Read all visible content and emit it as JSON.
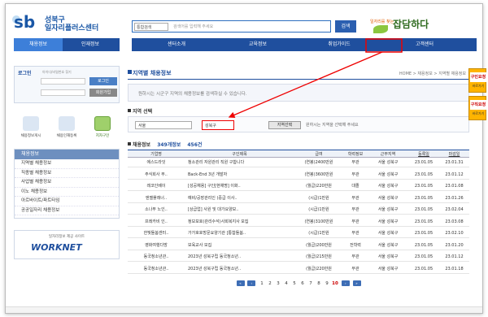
{
  "header": {
    "logo_mark": "sb",
    "logo_line1": "성북구",
    "logo_line2": "일자리플러스센터",
    "search_select": "통합검색",
    "search_placeholder": "검색어를 입력해 주세요",
    "search_button": "검색",
    "banner_small": "일자리를 찾는",
    "banner_big": "잡담하다"
  },
  "nav": {
    "left_tabs": [
      "채용정보",
      "인재정보"
    ],
    "right_tabs": [
      "센터소개",
      "교육정보",
      "취업가이드",
      "고객센터"
    ]
  },
  "sidebar": {
    "login_title": "로그인",
    "login_hint": "아이디/비밀번호 찾기",
    "login_button": "로그인",
    "join_button": "회원가입",
    "quick_items": [
      "채용정보게시",
      "채용인재등록",
      "지자구인"
    ],
    "job_menu_title": "채용정보",
    "job_menu_items": [
      "지역별 채용정보",
      "직종별 채용정보",
      "사업별 채용정보",
      "이노 채용정보",
      "아르바이트/파트타임",
      "공공일자리 채용정보"
    ],
    "work_top": "일자리정보 제공 사이트",
    "work_logo": "WORKNET"
  },
  "main": {
    "title": "지역별 채용정보",
    "breadcrumb": "HOME > 채용정보 > 지역별 채용정보",
    "desc": "원하시는 시군구 지역의 채용정보를 검색하실 수 있습니다.",
    "region_section": "지역 선택",
    "region_select1": "서울",
    "region_select2": "성북구",
    "region_button": "지역선택",
    "region_note": "원하시는 지역을 선택해 주세요",
    "list_section": "채용정보",
    "list_count": "349개정보",
    "list_pages": "456건",
    "columns": [
      "기업명",
      "구인제목",
      "급여",
      "학력정보",
      "근무지역",
      "등록일",
      "마감일"
    ],
    "rows": [
      [
        "에스드라잇",
        "청소관리 자원관리 직원 구합니다",
        "(연봉)2400만원",
        "무관",
        "서울 성북구",
        "23.01.05",
        "23.01.31"
      ],
      [
        "주식회사 무..",
        "Back-End 3년 개발자",
        "(연봉)3600만원",
        "무관",
        "서울 성북구",
        "23.01.05",
        "23.01.12"
      ],
      [
        "레코인베이",
        "[성공채용] 구인[현채명] 이화..",
        "(월급)220만원",
        "대졸",
        "서울 성북구",
        "23.01.05",
        "23.01.08"
      ],
      [
        "엔젤플래너..",
        "예비/공장관리인 (중급 이사..",
        "(시급)1만원",
        "무관",
        "서울 성북구",
        "23.01.05",
        "23.01.26"
      ],
      [
        "소나무 노인..",
        "[상급업] 사원 및 대가요양보..",
        "(시급)1만원",
        "무관",
        "서울 성북구",
        "23.01.05",
        "23.02.04"
      ],
      [
        "프레카비 인..",
        "정보보호(관리수석)사회복지사 모집",
        "(연봉)3100만원",
        "무관",
        "서울 성북구",
        "23.01.05",
        "23.03.08"
      ],
      [
        "한빛돌봄센터..",
        "가가호호방문요양기관 [통합돌봄..",
        "(시급)1만원",
        "무관",
        "서울 성북구",
        "23.01.05",
        "23.02.10"
      ],
      [
        "영화여행다방",
        "보육교사 모집",
        "(월급)200만원",
        "전학력",
        "서울 성북구",
        "23.01.05",
        "23.01.20"
      ],
      [
        "동국청소년관..",
        "2023년 성북구립 동국청소년..",
        "(월급)215만원",
        "무관",
        "서울 성북구",
        "23.01.05",
        "23.01.12"
      ],
      [
        "동국청소년관..",
        "2023년 성북구립 동국청소년..",
        "(월급)220만원",
        "무관",
        "서울 성북구",
        "23.01.05",
        "23.01.18"
      ]
    ],
    "pages": [
      "1",
      "2",
      "3",
      "4",
      "5",
      "6",
      "7",
      "8",
      "9",
      "10"
    ],
    "current_page": "10"
  },
  "right_banners": [
    {
      "label": "구인요청",
      "sub": "바로가기"
    },
    {
      "label": "구직요청",
      "sub": "바로가기"
    }
  ],
  "colors": {
    "brand": "#1f4f9e",
    "highlight": "#e00000"
  }
}
